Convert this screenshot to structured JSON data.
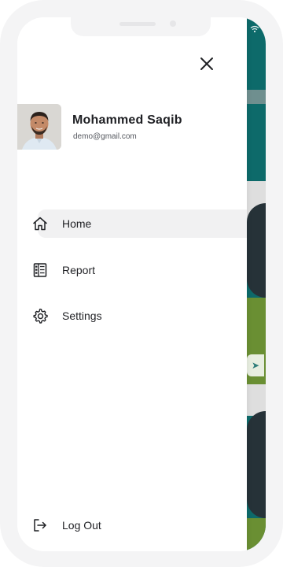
{
  "profile": {
    "name": "Mohammed Saqib",
    "email": "demo@gmail.com"
  },
  "menu": {
    "items": [
      {
        "label": "Home",
        "icon": "home-icon",
        "active": true
      },
      {
        "label": "Report",
        "icon": "report-icon",
        "active": false
      },
      {
        "label": "Settings",
        "icon": "gear-icon",
        "active": false
      }
    ],
    "logout_label": "Log Out",
    "logout_icon": "logout-icon"
  },
  "background_app": {
    "accent_color": "#0d6a6a",
    "secondary_color": "#6a8f33"
  }
}
